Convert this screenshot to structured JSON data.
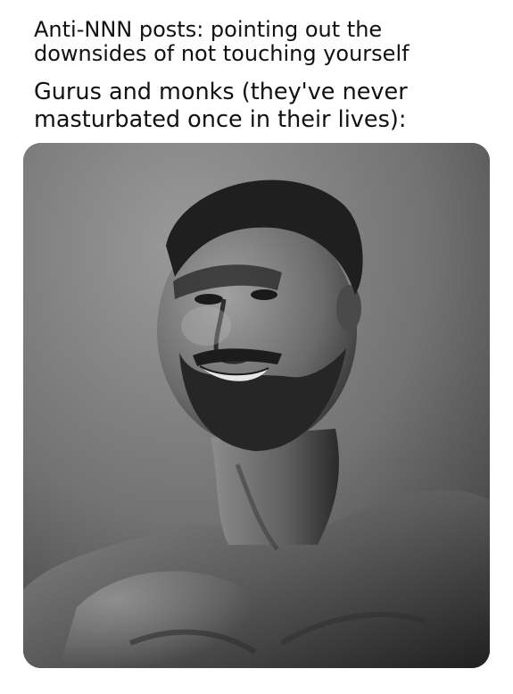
{
  "captions": {
    "top": {
      "lines": [
        "Anti-NNN posts: pointing out the",
        "downsides of not touching yourself"
      ]
    },
    "bottom": {
      "lines": [
        "Gurus and monks (they've never",
        "masturbated once in their lives):"
      ]
    }
  },
  "photo": {
    "subject": "bearded-muscular-man-grayscale-portrait",
    "colors": {
      "background_light": "#8d8d8d",
      "background_dark": "#3a3a3a",
      "skin_highlight": "#9a9a9a",
      "skin_shadow": "#262626",
      "hair": "#1f1f1f"
    }
  }
}
